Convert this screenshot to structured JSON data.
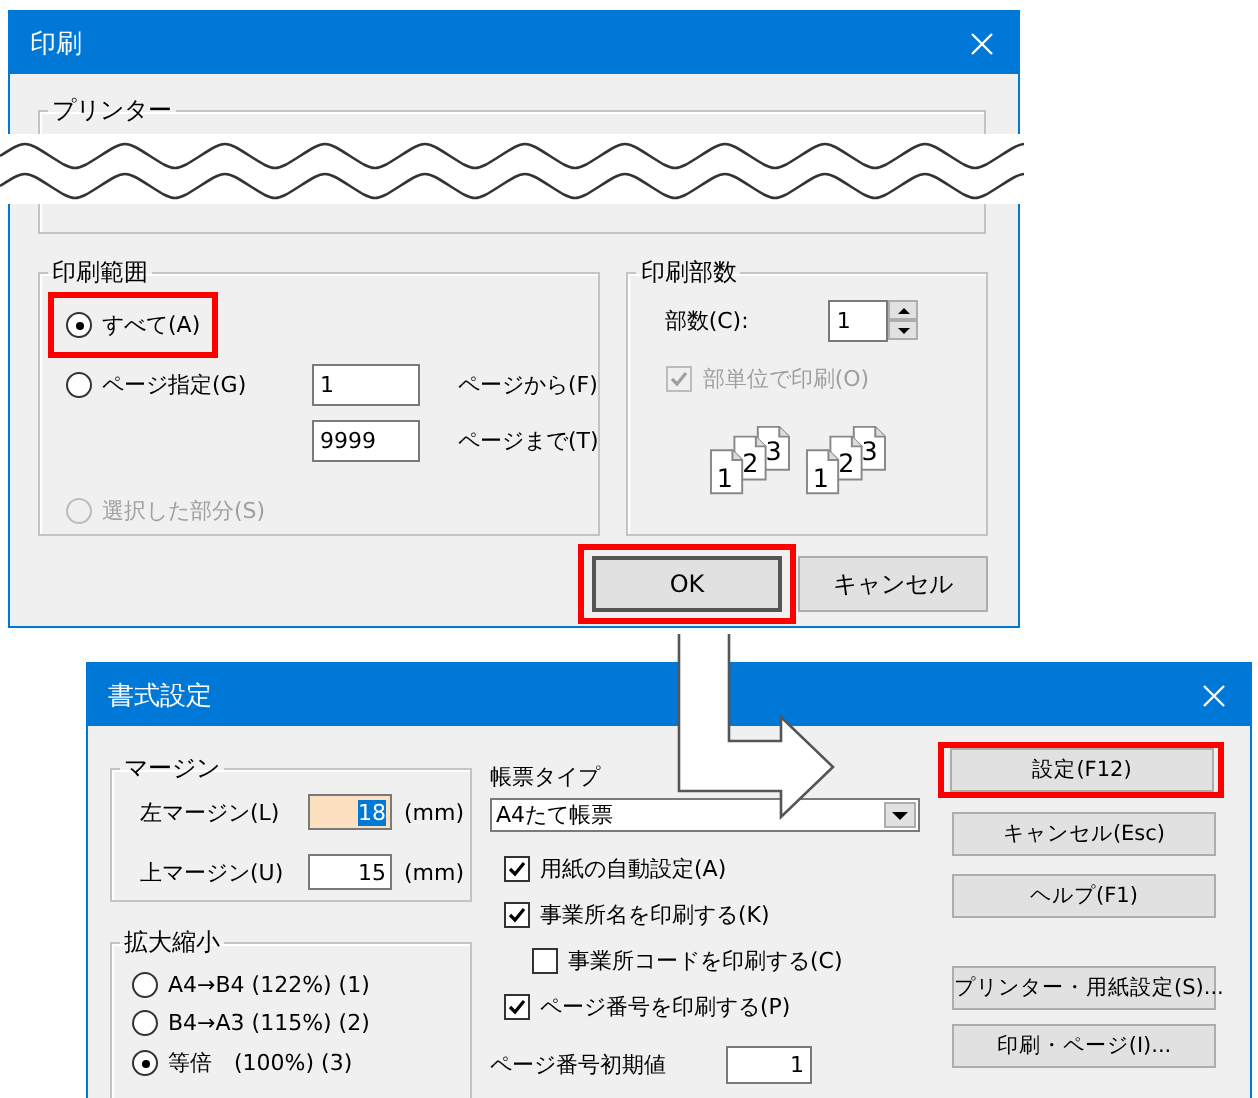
{
  "print_dialog": {
    "title": "印刷",
    "printer_group": {
      "label": "プリンター"
    },
    "range_group": {
      "label": "印刷範囲",
      "options": [
        {
          "label": "すべて(A)",
          "selected": true,
          "disabled": false,
          "highlighted": true
        },
        {
          "label": "ページ指定(G)",
          "selected": false,
          "disabled": false,
          "highlighted": false
        },
        {
          "label": "選択した部分(S)",
          "selected": false,
          "disabled": true,
          "highlighted": false
        }
      ],
      "page_from": {
        "value": "1",
        "label": "ページから(F)"
      },
      "page_to": {
        "value": "9999",
        "label": "ページまで(T)"
      }
    },
    "copies_group": {
      "label": "印刷部数",
      "copies": {
        "label": "部数(C):",
        "value": "1"
      },
      "collate": {
        "label": "部単位で印刷(O)",
        "checked": true,
        "disabled": true
      },
      "collate_icon_digits": [
        "1",
        "2",
        "3",
        "1",
        "2",
        "3"
      ]
    },
    "buttons": [
      {
        "label": "OK",
        "highlighted": true
      },
      {
        "label": "キャンセル",
        "highlighted": false
      }
    ]
  },
  "format_dialog": {
    "title": "書式設定",
    "margin_group": {
      "label": "マージン",
      "fields": [
        {
          "label": "左マージン(L)",
          "value": "18",
          "unit": "(mm)",
          "focused": true
        },
        {
          "label": "上マージン(U)",
          "value": "15",
          "unit": "(mm)",
          "focused": false
        }
      ]
    },
    "scale_group": {
      "label": "拡大縮小",
      "options": [
        {
          "label": "A4→B4 (122%) (1)",
          "selected": false
        },
        {
          "label": "B4→A3 (115%) (2)",
          "selected": false
        },
        {
          "label": "等倍　(100%) (3)",
          "selected": true
        }
      ]
    },
    "form_type": {
      "label": "帳票タイプ",
      "value": "A4たて帳票"
    },
    "checkboxes": [
      {
        "label": "用紙の自動設定(A)",
        "checked": true
      },
      {
        "label": "事業所名を印刷する(K)",
        "checked": true,
        "children": [
          {
            "label": "事業所コードを印刷する(C)",
            "checked": false
          }
        ]
      },
      {
        "label": "ページ番号を印刷する(P)",
        "checked": true
      }
    ],
    "start_page": {
      "label": "ページ番号初期値",
      "value": "1"
    },
    "button_groups": [
      [
        {
          "label": "設定(F12)",
          "highlighted": true
        },
        {
          "label": "キャンセル(Esc)",
          "highlighted": false
        },
        {
          "label": "ヘルプ(F1)",
          "highlighted": false
        }
      ],
      [
        {
          "label": "プリンター・用紙設定(S)...",
          "highlighted": false
        },
        {
          "label": "印刷・ページ(I)...",
          "highlighted": false
        }
      ]
    ]
  }
}
